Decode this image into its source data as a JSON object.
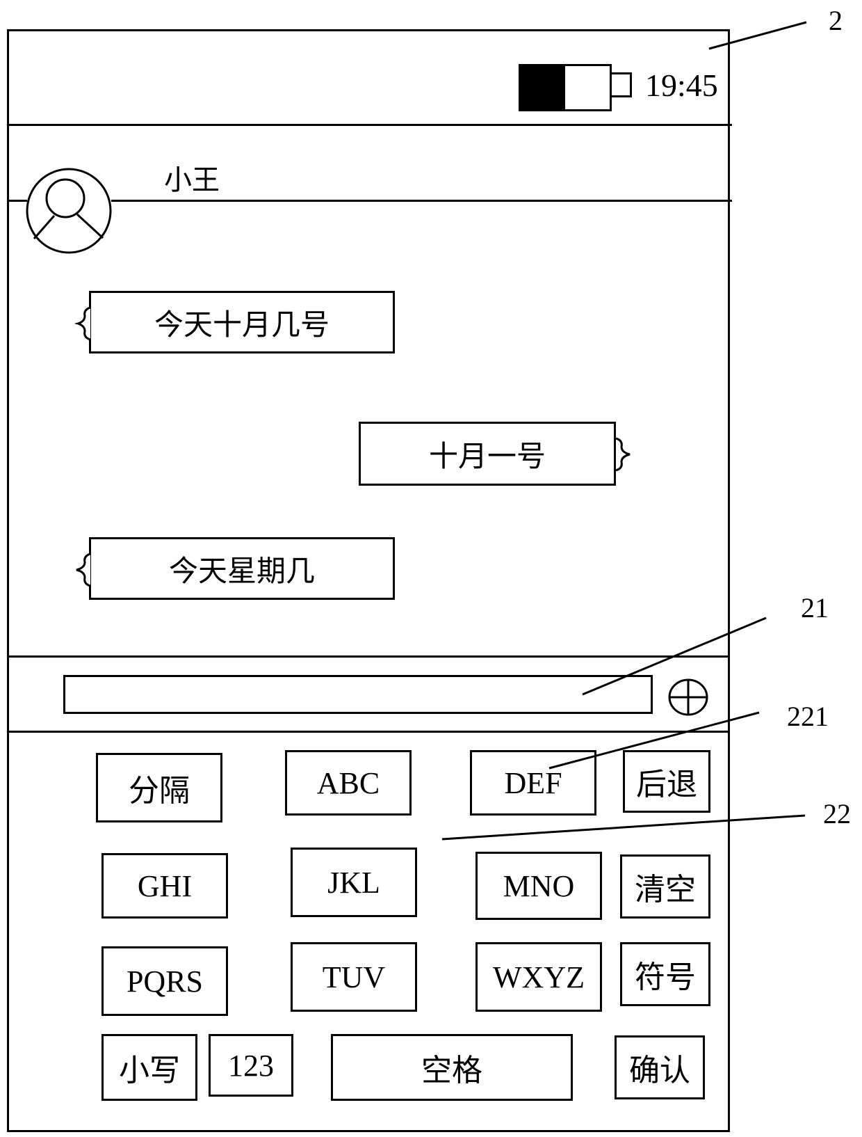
{
  "status_bar": {
    "time": "19:45",
    "battery_level": 0.5
  },
  "contact": {
    "name": "小王"
  },
  "messages": [
    {
      "side": "left",
      "text": "今天十月几号"
    },
    {
      "side": "right",
      "text": "十月一号"
    },
    {
      "side": "left",
      "text": "今天星期几"
    }
  ],
  "input": {
    "value": "",
    "placeholder": "",
    "add_icon": "plus-circle-icon"
  },
  "keyboard": {
    "rows": [
      [
        "分隔",
        "ABC",
        "DEF",
        "后退"
      ],
      [
        "GHI",
        "JKL",
        "MNO",
        "清空"
      ],
      [
        "PQRS",
        "TUV",
        "WXYZ",
        "符号"
      ],
      [
        "小写",
        "123",
        "空格",
        "确认"
      ]
    ]
  },
  "reference_labels": {
    "device": "2",
    "input_box": "21",
    "keyboard": "22",
    "key": "221"
  }
}
